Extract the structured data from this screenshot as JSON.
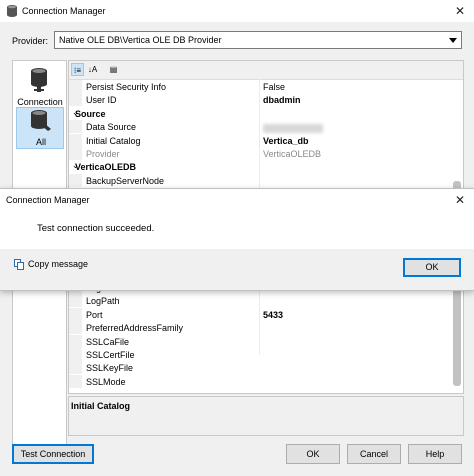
{
  "window": {
    "title": "Connection Manager",
    "close_glyph": "✕"
  },
  "provider": {
    "label": "Provider:",
    "value": "Native OLE DB\\Vertica OLE DB Provider"
  },
  "nav": [
    {
      "label": "Connection",
      "icon": "database-plug-icon"
    },
    {
      "label": "All",
      "icon": "database-plug-icon"
    }
  ],
  "grid": {
    "rows_top": [
      {
        "kind": "prop",
        "name": "Persist Security Info",
        "value": "False",
        "bold": false
      },
      {
        "kind": "prop",
        "name": "User ID",
        "value": "dbadmin",
        "bold": true
      },
      {
        "kind": "cat",
        "name": "Source",
        "value": ""
      },
      {
        "kind": "prop",
        "name": "Data Source",
        "value": "",
        "bold": false
      },
      {
        "kind": "prop",
        "name": "Initial Catalog",
        "value": "Vertica_db",
        "bold": true
      },
      {
        "kind": "prop",
        "name": "Provider",
        "value": "VerticaOLEDB",
        "bold": false,
        "grey": true
      },
      {
        "kind": "cat",
        "name": "VerticaOLEDB",
        "value": ""
      },
      {
        "kind": "prop",
        "name": "BackupServerNode",
        "value": "",
        "bold": false
      }
    ],
    "rows_bottom": [
      {
        "kind": "prop",
        "name": "LogLevel",
        "value": "",
        "bold": false
      },
      {
        "kind": "prop",
        "name": "LogPath",
        "value": "",
        "bold": false
      },
      {
        "kind": "prop",
        "name": "Port",
        "value": "5433",
        "bold": true
      },
      {
        "kind": "prop",
        "name": "PreferredAddressFamily",
        "value": "",
        "bold": false
      },
      {
        "kind": "prop",
        "name": "SSLCaFile",
        "value": "",
        "bold": false
      },
      {
        "kind": "prop",
        "name": "SSLCertFile",
        "value": "",
        "bold": false
      },
      {
        "kind": "prop",
        "name": "SSLKeyFile",
        "value": "",
        "bold": false
      },
      {
        "kind": "prop",
        "name": "SSLMode",
        "value": "",
        "bold": false
      }
    ]
  },
  "description": {
    "title": "Initial Catalog"
  },
  "buttons": {
    "test_connection": "Test Connection",
    "ok": "OK",
    "cancel": "Cancel",
    "help": "Help"
  },
  "dialog": {
    "title": "Connection Manager",
    "message": "Test connection succeeded.",
    "copy_message": "Copy message",
    "ok": "OK"
  },
  "colors": {
    "accent": "#0078d7",
    "selection": "#cce4f7"
  }
}
